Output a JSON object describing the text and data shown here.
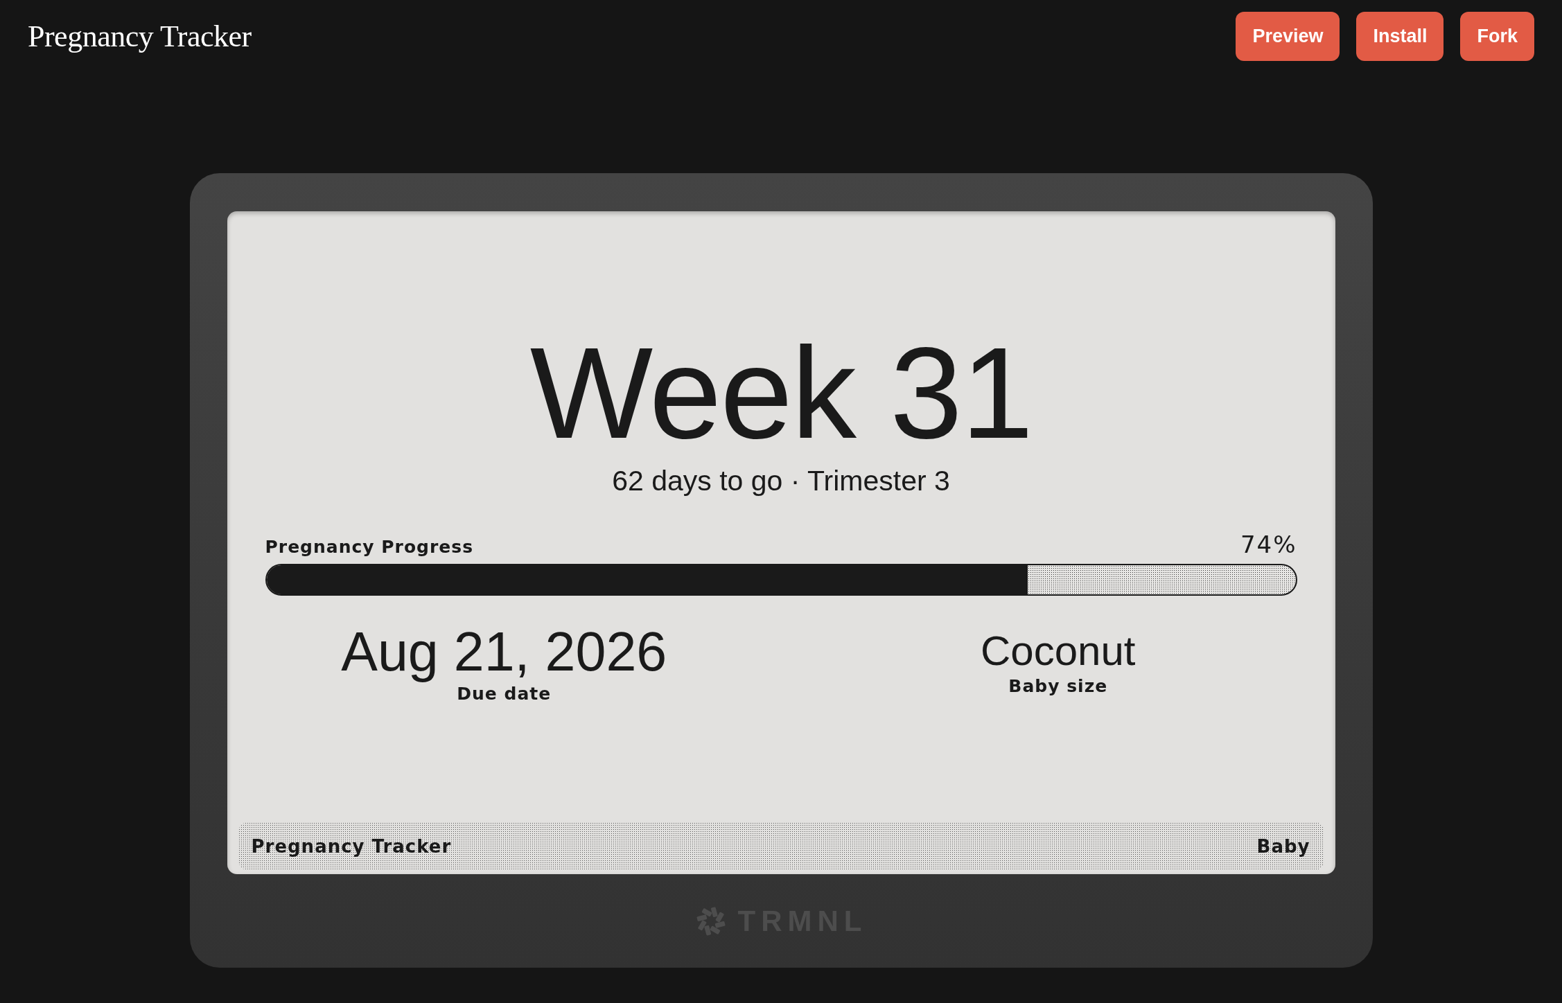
{
  "app": {
    "title": "Pregnancy Tracker",
    "buttons": [
      {
        "label": "Preview"
      },
      {
        "label": "Install"
      },
      {
        "label": "Fork"
      }
    ]
  },
  "device": {
    "screen": {
      "headline": "Week 31",
      "subtitle": "62 days to go · Trimester 3",
      "progress": {
        "label": "Pregnancy Progress",
        "reading": "74%",
        "level": 0.74
      },
      "stats": [
        {
          "kind": "large",
          "value": "Aug 21, 2026",
          "label": "Due date"
        },
        {
          "kind": "medium",
          "value": "Coconut",
          "label": "Baby size"
        }
      ],
      "title_bar": {
        "title": "Pregnancy Tracker",
        "instance": "Baby"
      }
    },
    "brand": "TRMNL"
  }
}
